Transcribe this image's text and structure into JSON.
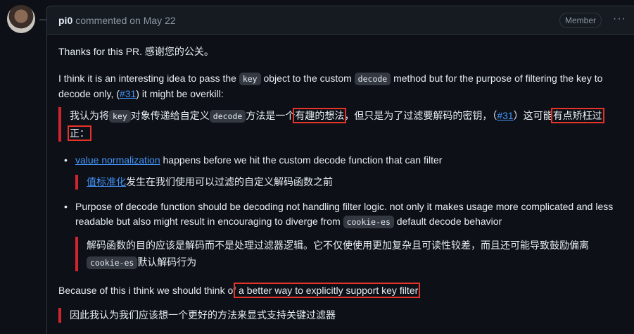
{
  "header": {
    "author": "pi0",
    "meta": "commented on May 22",
    "badge": "Member",
    "menu": "···"
  },
  "body": {
    "p1": "Thanks for this PR. 感谢您的公关。",
    "p2_a": "I think it is an interesting idea to pass the ",
    "p2_code1": "key",
    "p2_b": " object to the custom ",
    "p2_code2": "decode",
    "p2_c": " method but for the purpose of filtering the key to decode only, (",
    "p2_link": "#31",
    "p2_d": ") it might be overkill:",
    "bq1_a": "我认为将",
    "bq1_code1": "key",
    "bq1_b": "对象传递给自定义",
    "bq1_code2": "decode",
    "bq1_c": "方法是一个",
    "bq1_hl1": "有趣的想法",
    "bq1_d": "，但只是为了过滤要解码的密钥，（",
    "bq1_link": "#31",
    "bq1_e": "）这可能",
    "bq1_hl2": "有点矫枉过",
    "bq1_hl3": "正：",
    "li1_link": "value normalization",
    "li1_text": " happens before we hit the custom decode function that can filter",
    "bq2_link": "值标准化",
    "bq2_text": "发生在我们使用可以过滤的自定义解码函数之前",
    "li2_a": "Purpose of decode function should be decoding not handling filter logic. not only it makes usage more complicated and less readable but also might result in encouraging to diverge from ",
    "li2_code": "cookie-es",
    "li2_b": " default decode behavior",
    "bq3_a": "解码函数的目的应该是解码而不是处理过滤器逻辑。它不仅使使用更加复杂且可读性较差，而且还可能导致鼓励偏离",
    "bq3_code": "cookie-es",
    "bq3_b": "默认解码行为",
    "p3_a": "Because of this i think we should think of",
    "p3_hl": " a better way to explicitly support key filter",
    "bq4": "因此我认为我们应该想一个更好的方法来显式支持关键过滤器"
  },
  "colors": {
    "background": "#0d1117",
    "link": "#4493f8",
    "quote_border": "#d1242f",
    "highlight_box": "#e5332a"
  }
}
